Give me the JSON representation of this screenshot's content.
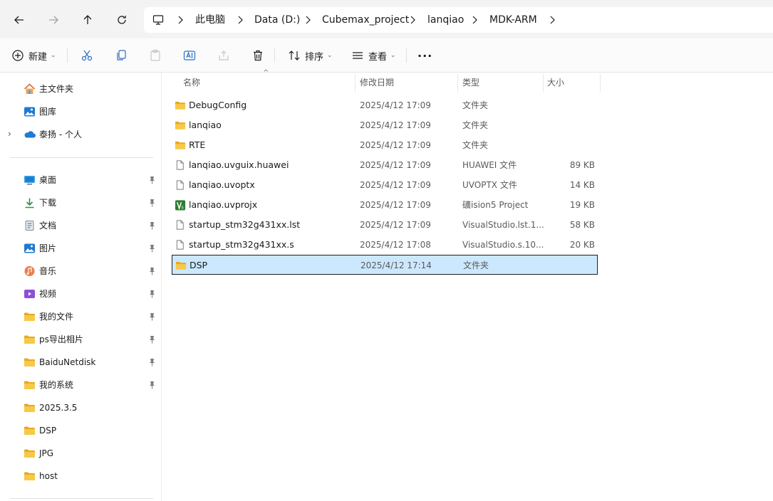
{
  "nav": {
    "back_icon": "arrow-left-icon",
    "forward_icon": "arrow-right-icon",
    "up_icon": "arrow-up-icon",
    "refresh_icon": "refresh-icon"
  },
  "address": {
    "crumbs": [
      "此电脑",
      "Data (D:)",
      "Cubemax_project",
      "lanqiao",
      "MDK-ARM"
    ]
  },
  "toolbar": {
    "new_label": "新建",
    "sort_label": "排序",
    "view_label": "查看",
    "more_label": "···"
  },
  "sidebar": {
    "top": [
      {
        "label": "主文件夹",
        "icon": "home-icon"
      },
      {
        "label": "图库",
        "icon": "gallery-icon"
      },
      {
        "label": "泰扬 - 个人",
        "icon": "onedrive-icon"
      }
    ],
    "pinned": [
      {
        "label": "桌面",
        "icon": "desktop-icon"
      },
      {
        "label": "下载",
        "icon": "download-icon"
      },
      {
        "label": "文档",
        "icon": "document-icon"
      },
      {
        "label": "图片",
        "icon": "pictures-icon"
      },
      {
        "label": "音乐",
        "icon": "music-icon"
      },
      {
        "label": "视频",
        "icon": "video-icon"
      },
      {
        "label": "我的文件",
        "icon": "folder-icon"
      },
      {
        "label": "ps导出相片",
        "icon": "folder-icon"
      },
      {
        "label": "BaiduNetdisk",
        "icon": "folder-icon"
      },
      {
        "label": "我的系统",
        "icon": "folder-icon"
      },
      {
        "label": "2025.3.5",
        "icon": "folder-icon"
      },
      {
        "label": "DSP",
        "icon": "folder-icon"
      },
      {
        "label": "JPG",
        "icon": "folder-icon"
      },
      {
        "label": "host",
        "icon": "folder-icon"
      }
    ]
  },
  "columns": {
    "name": "名称",
    "date": "修改日期",
    "type": "类型",
    "size": "大小"
  },
  "files": [
    {
      "name": "DebugConfig",
      "date": "2025/4/12 17:09",
      "type": "文件夹",
      "size": "",
      "icon": "folder-icon"
    },
    {
      "name": "lanqiao",
      "date": "2025/4/12 17:09",
      "type": "文件夹",
      "size": "",
      "icon": "folder-icon"
    },
    {
      "name": "RTE",
      "date": "2025/4/12 17:09",
      "type": "文件夹",
      "size": "",
      "icon": "folder-icon"
    },
    {
      "name": "lanqiao.uvguix.huawei",
      "date": "2025/4/12 17:09",
      "type": "HUAWEI 文件",
      "size": "89 KB",
      "icon": "file-icon"
    },
    {
      "name": "lanqiao.uvoptx",
      "date": "2025/4/12 17:09",
      "type": "UVOPTX 文件",
      "size": "14 KB",
      "icon": "file-icon"
    },
    {
      "name": "lanqiao.uvprojx",
      "date": "2025/4/12 17:09",
      "type": "礦ision5 Project",
      "size": "19 KB",
      "icon": "keil-project-icon"
    },
    {
      "name": "startup_stm32g431xx.lst",
      "date": "2025/4/12 17:09",
      "type": "VisualStudio.lst.1...",
      "size": "58 KB",
      "icon": "file-icon"
    },
    {
      "name": "startup_stm32g431xx.s",
      "date": "2025/4/12 17:08",
      "type": "VisualStudio.s.10...",
      "size": "20 KB",
      "icon": "file-icon"
    },
    {
      "name": "DSP",
      "date": "2025/4/12 17:14",
      "type": "文件夹",
      "size": "",
      "icon": "folder-icon",
      "selected": true
    }
  ],
  "colors": {
    "folder": "#f5c04a",
    "selection": "#cce8ff",
    "accent": "#0067c0"
  }
}
